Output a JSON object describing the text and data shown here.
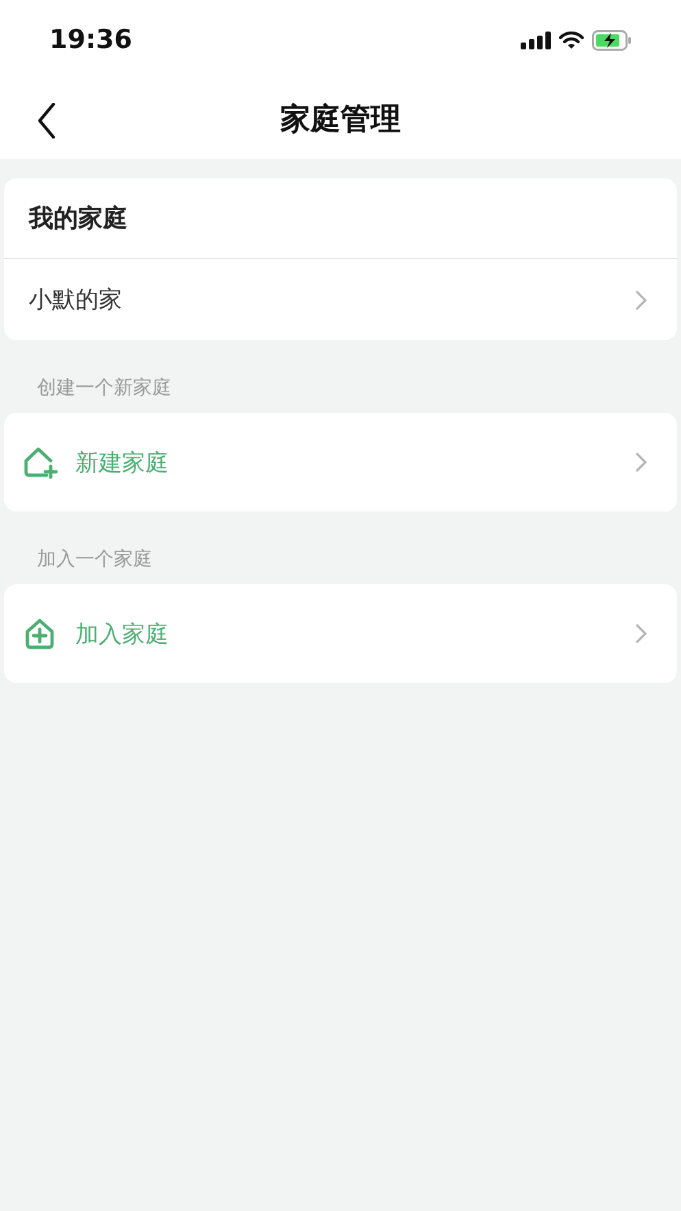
{
  "status_bar": {
    "time": "19:36"
  },
  "nav": {
    "title": "家庭管理"
  },
  "my_families": {
    "heading": "我的家庭",
    "items": [
      {
        "name": "小默的家"
      }
    ]
  },
  "sections": [
    {
      "label": "创建一个新家庭",
      "action": {
        "kind": "create",
        "label": "新建家庭"
      }
    },
    {
      "label": "加入一个家庭",
      "action": {
        "kind": "join",
        "label": "加入家庭"
      }
    }
  ]
}
